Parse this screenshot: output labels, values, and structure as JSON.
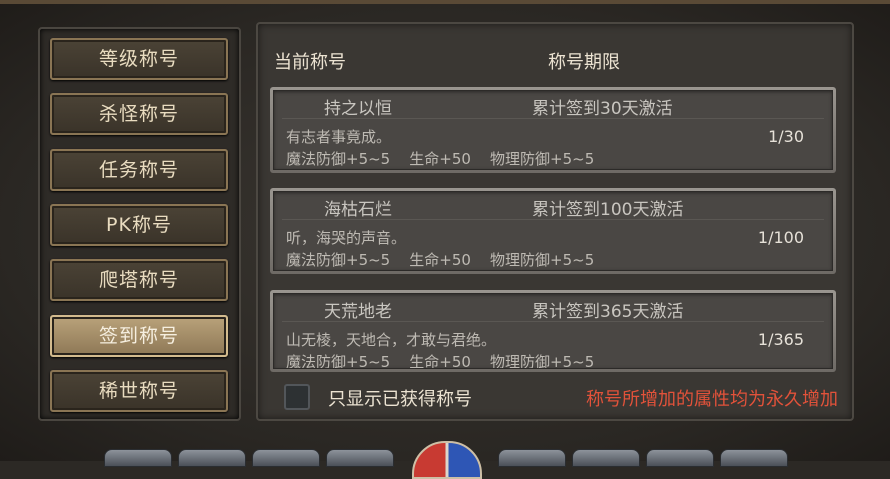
{
  "tabs": [
    {
      "label": "等级称号",
      "active": false
    },
    {
      "label": "杀怪称号",
      "active": false
    },
    {
      "label": "任务称号",
      "active": false
    },
    {
      "label": "PK称号",
      "active": false
    },
    {
      "label": "爬塔称号",
      "active": false
    },
    {
      "label": "签到称号",
      "active": true
    },
    {
      "label": "稀世称号",
      "active": false
    }
  ],
  "header": {
    "current_title": "当前称号",
    "title_period": "称号期限"
  },
  "titles": [
    {
      "name": "持之以恒",
      "condition": "累计签到30天激活",
      "desc": "有志者事竟成。",
      "attrs": "魔法防御+5~5    生命+50    物理防御+5~5",
      "progress": "1/30"
    },
    {
      "name": "海枯石烂",
      "condition": "累计签到100天激活",
      "desc": "听，海哭的声音。",
      "attrs": "魔法防御+5~5    生命+50    物理防御+5~5",
      "progress": "1/100"
    },
    {
      "name": "天荒地老",
      "condition": "累计签到365天激活",
      "desc": "山无棱，天地合，才敢与君绝。",
      "attrs": "魔法防御+5~5    生命+50    物理防御+5~5",
      "progress": "1/365"
    }
  ],
  "filter": {
    "label": "只显示已获得称号",
    "checked": false
  },
  "note": "称号所增加的属性均为永久增加",
  "colors": {
    "note": "#e2523a",
    "tab_active": "#b9a27a",
    "tab_border": "#8a7554"
  }
}
